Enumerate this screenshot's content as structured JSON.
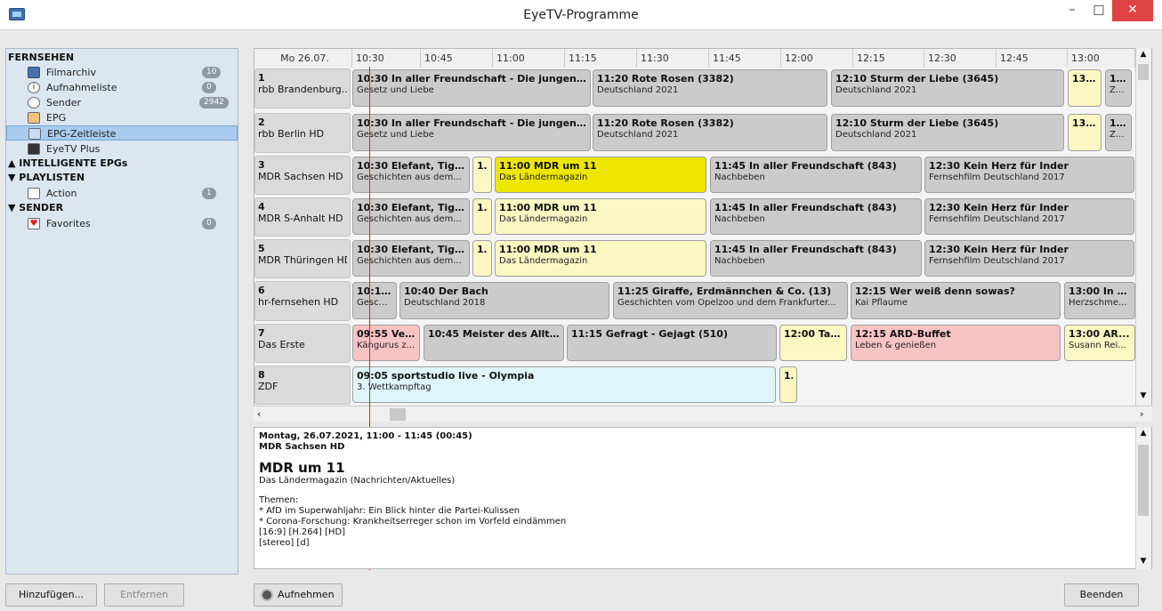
{
  "window": {
    "title": "EyeTV-Programme",
    "close_glyph": "✕",
    "min_glyph": "–",
    "max_glyph": "□"
  },
  "sidebar": {
    "sections": [
      {
        "label": "FERNSEHEN"
      },
      {
        "label": "▲ INTELLIGENTE EPGs"
      },
      {
        "label": "▼ PLAYLISTEN"
      },
      {
        "label": "▼ SENDER"
      }
    ],
    "items": [
      {
        "label": "Filmarchiv",
        "badge": "10",
        "icon": "film-archive-icon"
      },
      {
        "label": "Aufnahmeliste",
        "badge": "0",
        "icon": "info-icon"
      },
      {
        "label": "Sender",
        "badge": "2942",
        "icon": "satellite-icon"
      },
      {
        "label": "EPG",
        "badge": "",
        "icon": "epg-icon"
      },
      {
        "label": "EPG-Zeitleiste",
        "badge": "",
        "icon": "epg-timeline-icon"
      },
      {
        "label": "EyeTV Plus",
        "badge": "",
        "icon": "eyetv-plus-icon"
      },
      {
        "label": "Action",
        "badge": "1",
        "icon": "playlist-icon"
      },
      {
        "label": "Favorites",
        "badge": "0",
        "icon": "heart-icon"
      }
    ]
  },
  "epg": {
    "date_label": "Mo 26.07.",
    "times": [
      "10:30",
      "10:45",
      "11:00",
      "11:15",
      "11:30",
      "11:45",
      "12:00",
      "12:15",
      "12:30",
      "12:45",
      "13:00"
    ],
    "channels": [
      {
        "num": "1",
        "name": "rbb Brandenburg..."
      },
      {
        "num": "2",
        "name": "rbb Berlin HD"
      },
      {
        "num": "3",
        "name": "MDR Sachsen HD"
      },
      {
        "num": "4",
        "name": "MDR S-Anhalt HD"
      },
      {
        "num": "5",
        "name": "MDR Thüringen HD"
      },
      {
        "num": "6",
        "name": "hr-fernsehen HD"
      },
      {
        "num": "7",
        "name": "Das Erste"
      },
      {
        "num": "8",
        "name": "ZDF"
      }
    ],
    "programs": [
      [
        {
          "t": "10:30 In aller Freundschaft - Die jungen ...",
          "s": "Gesetz und Liebe",
          "c": "grey"
        },
        {
          "t": "11:20 Rote Rosen (3382)",
          "s": "Deutschland 2021",
          "c": "grey"
        },
        {
          "t": "12:10 Sturm der Liebe (3645)",
          "s": "Deutschland 2021",
          "c": "grey"
        },
        {
          "t": "13:00...",
          "s": "",
          "c": "lyel"
        },
        {
          "t": "1...",
          "s": "Z...",
          "c": "grey"
        }
      ],
      [
        {
          "t": "10:30 In aller Freundschaft - Die jungen ...",
          "s": "Gesetz und Liebe",
          "c": "grey"
        },
        {
          "t": "11:20 Rote Rosen (3382)",
          "s": "Deutschland 2021",
          "c": "grey"
        },
        {
          "t": "12:10 Sturm der Liebe (3645)",
          "s": "Deutschland 2021",
          "c": "grey"
        },
        {
          "t": "13:00...",
          "s": "",
          "c": "lyel"
        },
        {
          "t": "1...",
          "s": "Z...",
          "c": "grey"
        }
      ],
      [
        {
          "t": "10:30 Elefant, Tige...",
          "s": "Geschichten aus dem...",
          "c": "grey"
        },
        {
          "t": "1...",
          "s": "",
          "c": "lyel"
        },
        {
          "t": "11:00 MDR um 11",
          "s": "Das Ländermagazin",
          "c": "yel"
        },
        {
          "t": "11:45 In aller Freundschaft (843)",
          "s": "Nachbeben",
          "c": "grey"
        },
        {
          "t": "12:30 Kein Herz für Inder",
          "s": "Fernsehfilm Deutschland 2017",
          "c": "grey"
        }
      ],
      [
        {
          "t": "10:30 Elefant, Tige...",
          "s": "Geschichten aus dem...",
          "c": "grey"
        },
        {
          "t": "1...",
          "s": "",
          "c": "lyel"
        },
        {
          "t": "11:00 MDR um 11",
          "s": "Das Ländermagazin",
          "c": "lyel"
        },
        {
          "t": "11:45 In aller Freundschaft (843)",
          "s": "Nachbeben",
          "c": "grey"
        },
        {
          "t": "12:30 Kein Herz für Inder",
          "s": "Fernsehfilm Deutschland 2017",
          "c": "grey"
        }
      ],
      [
        {
          "t": "10:30 Elefant, Tige...",
          "s": "Geschichten aus dem...",
          "c": "grey"
        },
        {
          "t": "1...",
          "s": "",
          "c": "lyel"
        },
        {
          "t": "11:00 MDR um 11",
          "s": "Das Ländermagazin",
          "c": "lyel"
        },
        {
          "t": "11:45 In aller Freundschaft (843)",
          "s": "Nachbeben",
          "c": "grey"
        },
        {
          "t": "12:30 Kein Herz für Inder",
          "s": "Fernsehfilm Deutschland 2017",
          "c": "grey"
        }
      ],
      [
        {
          "t": "10:15...",
          "s": "Gesch...",
          "c": "grey"
        },
        {
          "t": "10:40 Der Bach",
          "s": "Deutschland 2018",
          "c": "grey"
        },
        {
          "t": "11:25 Giraffe, Erdmännchen & Co. (13)",
          "s": "Geschichten vom Opelzoo und dem Frankfurter...",
          "c": "grey"
        },
        {
          "t": "12:15 Wer weiß denn sowas?",
          "s": "Kai Pflaume",
          "c": "grey"
        },
        {
          "t": "13:00 In a...",
          "s": "Herzschme...",
          "c": "grey"
        }
      ],
      [
        {
          "t": "09:55 Ver...",
          "s": "Kängurus z...",
          "c": "pink"
        },
        {
          "t": "10:45 Meister des Allta...",
          "s": "",
          "c": "grey"
        },
        {
          "t": "11:15 Gefragt - Gejagt (510)",
          "s": "",
          "c": "grey"
        },
        {
          "t": "12:00 Tag...",
          "s": "",
          "c": "lyel"
        },
        {
          "t": "12:15 ARD-Buffet",
          "s": "Leben & genießen",
          "c": "pink"
        },
        {
          "t": "13:00 AR...",
          "s": "Susann Rei...",
          "c": "lyel"
        }
      ],
      [
        {
          "t": "09:05 sportstudio live - Olympia",
          "s": "3. Wettkampftag",
          "c": "cyan"
        },
        {
          "t": "1...",
          "s": "",
          "c": "lyel"
        }
      ]
    ]
  },
  "detail": {
    "line1": "Montag, 26.07.2021, 11:00 - 11:45  (00:45)",
    "line2": "MDR Sachsen HD",
    "title": "MDR um 11",
    "subtitle": "Das Ländermagazin  (Nachrichten/Aktuelles)",
    "body": [
      "Themen:",
      "* AfD im Superwahljahr: Ein Blick hinter die Partei-Kulissen",
      "* Corona-Forschung: Krankheitserreger schon im Vorfeld eindämmen",
      "[16:9] [H.264] [HD]",
      "[stereo] [d]"
    ]
  },
  "buttons": {
    "add": "Hinzufügen...",
    "remove": "Entfernen",
    "record": "Aufnehmen",
    "quit": "Beenden"
  },
  "colors": {
    "grey": "#cbcbcb",
    "light_yellow": "#fbf7c2",
    "yellow": "#ece600",
    "pink": "#f8c3c3",
    "cyan": "#dff5fb",
    "now_line": "#e02020"
  }
}
